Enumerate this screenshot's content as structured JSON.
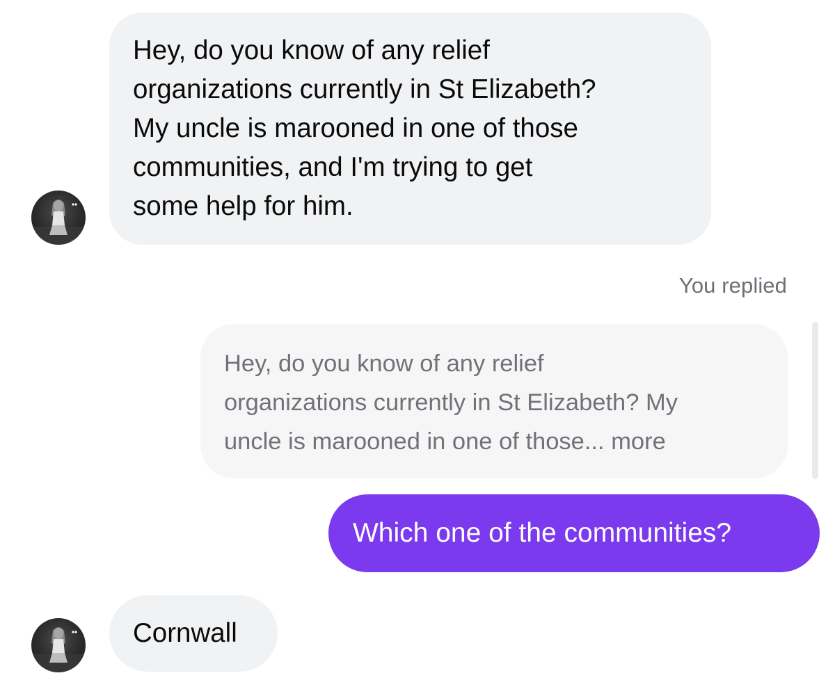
{
  "messages": {
    "incoming_1": {
      "lines": [
        "Hey, do you know of any relief",
        "organizations currently in St Elizabeth?",
        "My uncle is marooned in one of those",
        "communities, and I'm trying to get",
        "some help for him."
      ]
    },
    "replied_label": "You replied",
    "quoted": {
      "lines": [
        "Hey, do you know of any relief",
        "organizations currently in St Elizabeth? My",
        "uncle is marooned in one of those..."
      ],
      "more_label": "more"
    },
    "outgoing_1": {
      "text": "Which one of the communities?"
    },
    "incoming_2": {
      "text": "Cornwall"
    }
  },
  "colors": {
    "incoming_bubble": "#f1f2f4",
    "outgoing_bubble": "#7b3aed",
    "quote_text": "#6f7278"
  }
}
